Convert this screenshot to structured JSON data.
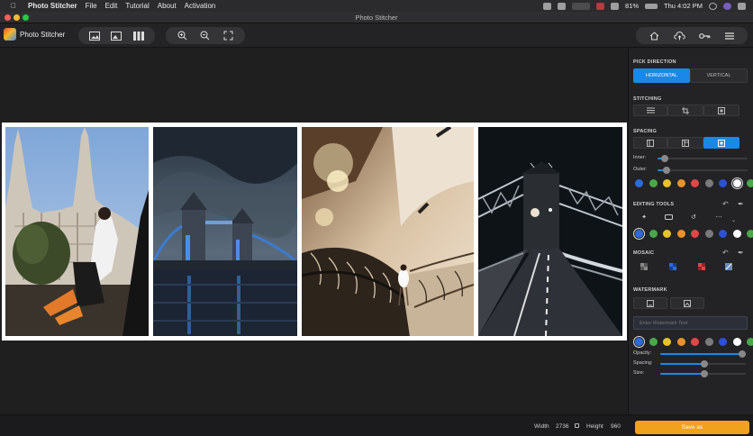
{
  "menubar": {
    "apple_icon": "apple-icon",
    "items": [
      "Photo Stitcher",
      "File",
      "Edit",
      "Tutorial",
      "About",
      "Activation"
    ],
    "battery": "81%",
    "clock": "Thu 4:02 PM"
  },
  "window": {
    "title": "Photo Stitcher"
  },
  "toolbar": {
    "app_name": "Photo Stitcher",
    "layout_buttons": [
      "add-image-icon",
      "replace-image-icon",
      "columns-icon"
    ],
    "view_buttons": [
      "zoom-in-icon",
      "zoom-out-icon",
      "fit-screen-icon"
    ],
    "right_buttons": [
      "home-icon",
      "cloud-upload-icon",
      "key-icon",
      "menu-list-icon"
    ]
  },
  "panel": {
    "pick_direction": {
      "title": "PICK DIRECTION",
      "horizontal": "HORIZONTAL",
      "vertical": "VERTICAL",
      "selected": "HORIZONTAL"
    },
    "stitching": {
      "title": "STITCHING"
    },
    "spacing": {
      "title": "SPACING",
      "inner_label": "Inner:",
      "outer_label": "Outer:",
      "inner_value": 0.08,
      "outer_value": 0.1,
      "colors": [
        "#2d6bd9",
        "#4aa84a",
        "#e8c22a",
        "#e8922a",
        "#e04646",
        "#7a7a7a",
        "#2d50d9",
        "#ffffff",
        "#4aa84a"
      ],
      "selected_color": "#ffffff"
    },
    "editing_tools": {
      "title": "EDITING TOOLS",
      "colors": [
        "#2d6bd9",
        "#4aa84a",
        "#e8c22a",
        "#e8922a",
        "#e04646",
        "#7a7a7a",
        "#2d50d9",
        "#ffffff",
        "#4aa84a"
      ],
      "selected_color": "#2d6bd9"
    },
    "mosaic": {
      "title": "MOSAIC"
    },
    "watermark": {
      "title": "WATERMARK",
      "placeholder": "Enter Watermark Text",
      "colors": [
        "#2d6bd9",
        "#4aa84a",
        "#e8c22a",
        "#e8922a",
        "#e04646",
        "#7a7a7a",
        "#2d50d9",
        "#ffffff",
        "#4aa84a"
      ],
      "selected_color": "#2d6bd9",
      "opacity_label": "Opacity:",
      "spacing_label": "Spacing:",
      "size_label": "Size:",
      "opacity_value": 1.0,
      "spacing_value": 0.52,
      "size_value": 0.52
    }
  },
  "bottom": {
    "width_label": "Width",
    "width_value": "2736",
    "height_label": "Height",
    "height_value": "960",
    "save_label": "Save as"
  },
  "colors": {
    "accent": "#1a88e8",
    "save": "#f0a11e"
  }
}
